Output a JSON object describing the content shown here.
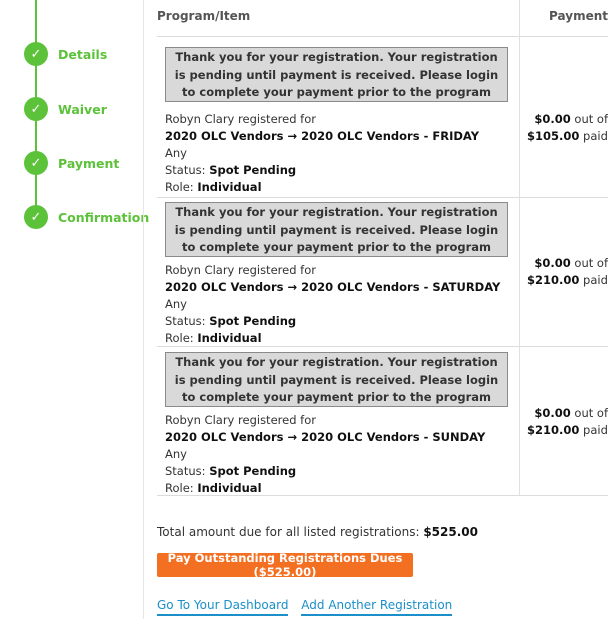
{
  "steps": [
    {
      "label": "Details"
    },
    {
      "label": "Waiver"
    },
    {
      "label": "Payment"
    },
    {
      "label": "Confirmation"
    }
  ],
  "step_check": "✓",
  "table": {
    "header_program": "Program/Item",
    "header_payment": "Payment"
  },
  "rows": [
    {
      "notice": "Thank you for your registration. Your registration is pending until payment is received. Please login to complete your payment prior to the program start date.",
      "registrant_line": "Robyn Clary registered for",
      "program": "2020 OLC Vendors → 2020 OLC Vendors - FRIDAY",
      "option": "Any",
      "status_label": "Status:",
      "status_value": "Spot Pending",
      "role_label": "Role:",
      "role_value": "Individual",
      "paid": "$0.00",
      "out_of": "out of",
      "total": "$105.00",
      "paid_suffix": "paid."
    },
    {
      "notice": "Thank you for your registration. Your registration is pending until payment is received. Please login to complete your payment prior to the program start date.",
      "registrant_line": "Robyn Clary registered for",
      "program": "2020 OLC Vendors → 2020 OLC Vendors - SATURDAY",
      "option": "Any",
      "status_label": "Status:",
      "status_value": "Spot Pending",
      "role_label": "Role:",
      "role_value": "Individual",
      "paid": "$0.00",
      "out_of": "out of",
      "total": "$210.00",
      "paid_suffix": "paid."
    },
    {
      "notice": "Thank you for your registration. Your registration is pending until payment is received. Please login to complete your payment prior to the program start date.",
      "registrant_line": "Robyn Clary registered for",
      "program": "2020 OLC Vendors → 2020 OLC Vendors - SUNDAY",
      "option": "Any",
      "status_label": "Status:",
      "status_value": "Spot Pending",
      "role_label": "Role:",
      "role_value": "Individual",
      "paid": "$0.00",
      "out_of": "out of",
      "total": "$210.00",
      "paid_suffix": "paid."
    }
  ],
  "summary": {
    "total_label": "Total amount due for all listed registrations:",
    "total_value": "$525.00"
  },
  "actions": {
    "pay_button": "Pay Outstanding Registrations Dues ($525.00)",
    "dashboard_link": "Go To Your Dashboard",
    "add_link": "Add Another Registration"
  },
  "colors": {
    "step_green": "#5cc23a",
    "button_orange": "#f36f21",
    "link_blue": "#1a8fc9",
    "notice_bg": "#d9d9d9"
  }
}
